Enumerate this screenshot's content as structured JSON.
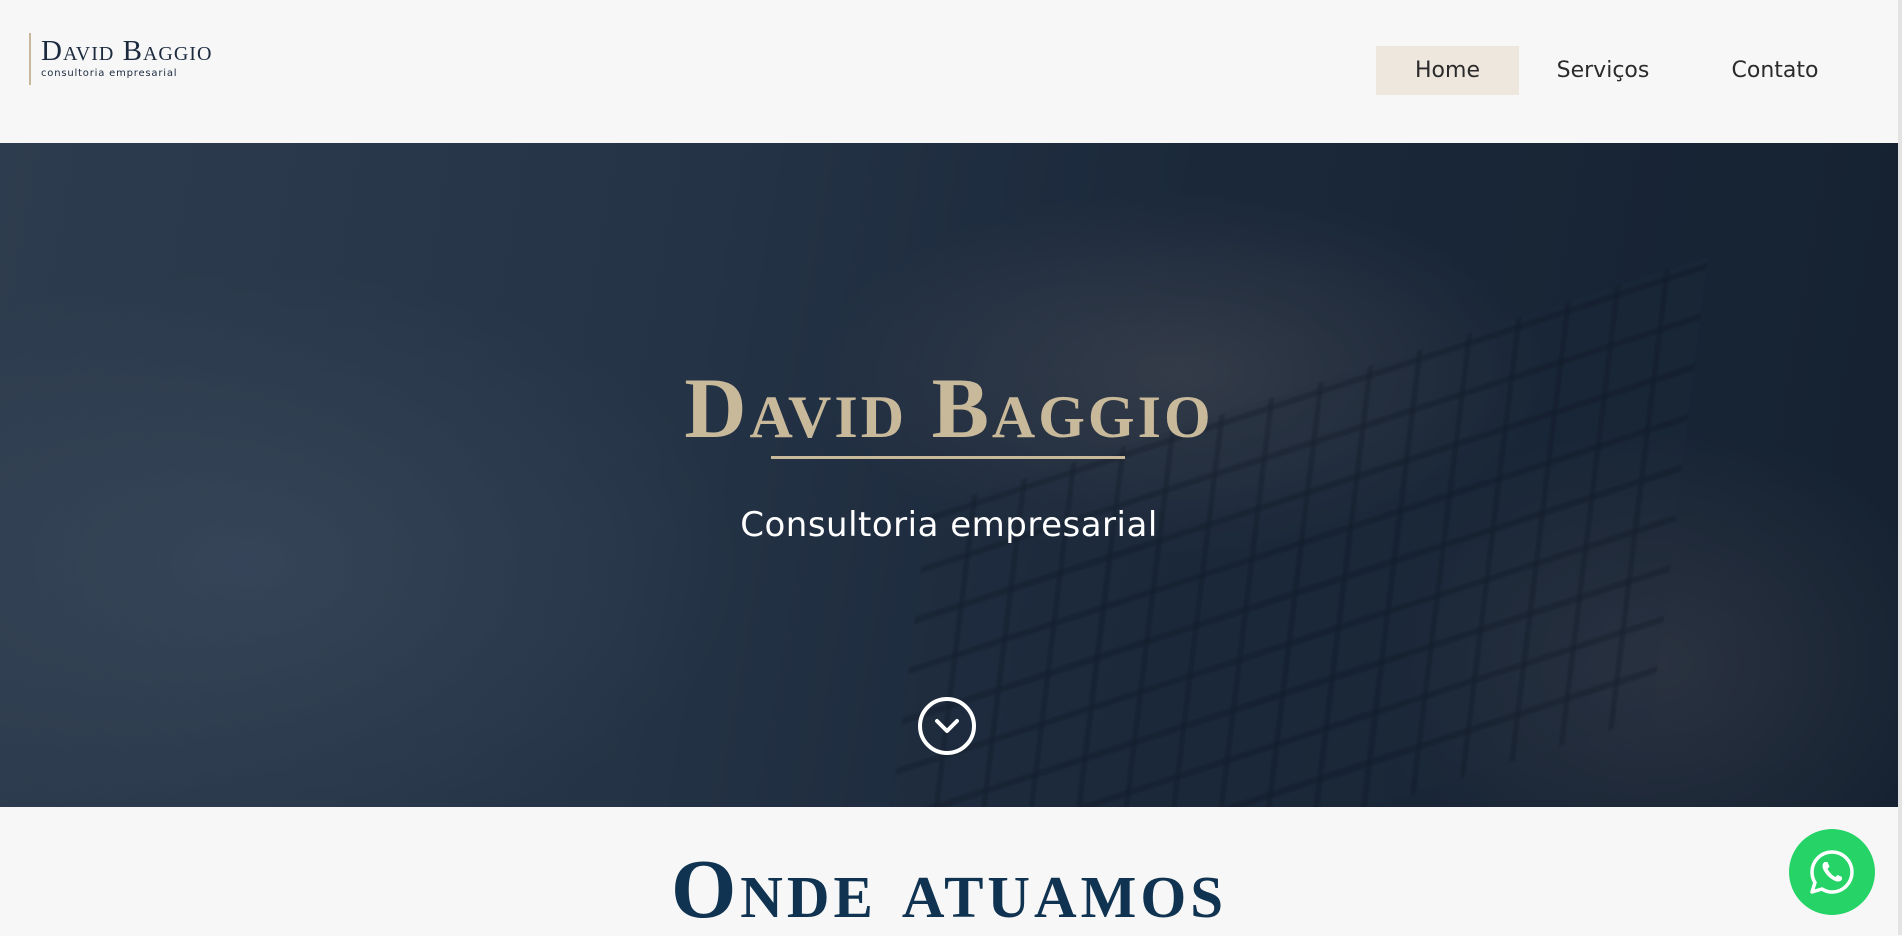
{
  "header": {
    "logo_name": "David Baggio",
    "logo_tagline": "consultoria empresarial",
    "nav": [
      {
        "label": "Home",
        "active": true
      },
      {
        "label": "Serviços",
        "active": false
      },
      {
        "label": "Contato",
        "active": false
      }
    ]
  },
  "hero": {
    "title": "David Baggio",
    "subtitle": "Consultoria empresarial",
    "scroll_icon": "chevron-down-circle-icon"
  },
  "section": {
    "title": "Onde atuamos"
  },
  "floating": {
    "whatsapp_icon": "whatsapp-icon"
  },
  "colors": {
    "accent_gold": "#c9b99b",
    "navy": "#0f3350",
    "nav_active_bg": "#ede7dd",
    "whatsapp_green": "#25d366"
  }
}
